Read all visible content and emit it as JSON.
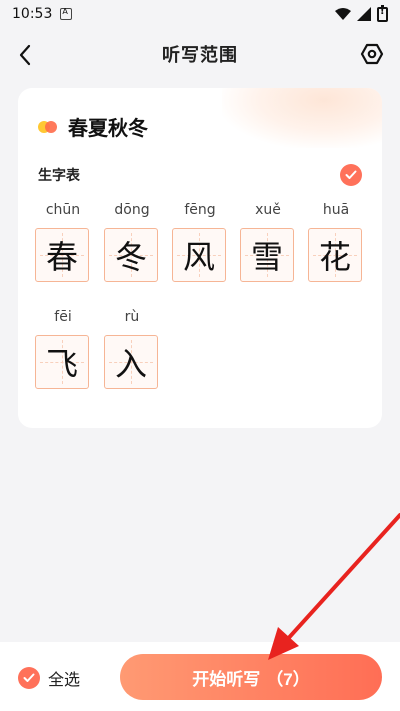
{
  "status_bar": {
    "time": "10:53"
  },
  "nav": {
    "title": "听写范围"
  },
  "lesson": {
    "title": "春夏秋冬"
  },
  "section": {
    "label": "生字表"
  },
  "characters": [
    {
      "pinyin": "chūn",
      "char": "春"
    },
    {
      "pinyin": "dōng",
      "char": "冬"
    },
    {
      "pinyin": "fēng",
      "char": "风"
    },
    {
      "pinyin": "xuě",
      "char": "雪"
    },
    {
      "pinyin": "huā",
      "char": "花"
    },
    {
      "pinyin": "fēi",
      "char": "飞"
    },
    {
      "pinyin": "rù",
      "char": "入"
    }
  ],
  "bottom": {
    "select_all_label": "全选",
    "start_label": "开始听写",
    "start_count": "（7）"
  },
  "colors": {
    "accent": "#ff715a",
    "arrow": "#e8231f"
  }
}
